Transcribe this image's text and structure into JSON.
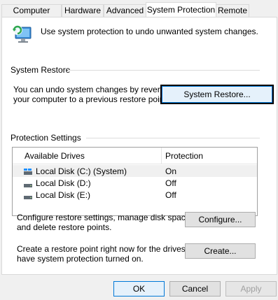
{
  "tabs": [
    {
      "label": "Computer Name"
    },
    {
      "label": "Hardware"
    },
    {
      "label": "Advanced"
    },
    {
      "label": "System Protection"
    },
    {
      "label": "Remote"
    }
  ],
  "intro": {
    "text": "Use system protection to undo unwanted system changes."
  },
  "system_restore": {
    "title": "System Restore",
    "desc_line1": "You can undo system changes by reverting",
    "desc_line2": "your computer to a previous restore point.",
    "button": "System Restore..."
  },
  "protection_settings": {
    "title": "Protection Settings",
    "headers": {
      "drives": "Available Drives",
      "protection": "Protection"
    },
    "rows": [
      {
        "drive": "Local Disk (C:) (System)",
        "protection": "On"
      },
      {
        "drive": "Local Disk (D:)",
        "protection": "Off"
      },
      {
        "drive": "Local Disk (E:)",
        "protection": "Off"
      }
    ]
  },
  "configure": {
    "line1": "Configure restore settings, manage disk space,",
    "line2": "and delete restore points.",
    "button": "Configure..."
  },
  "create": {
    "line1": "Create a restore point right now for the drives that",
    "line2": "have system protection turned on.",
    "button": "Create..."
  },
  "footer": {
    "ok": "OK",
    "cancel": "Cancel",
    "apply": "Apply"
  }
}
